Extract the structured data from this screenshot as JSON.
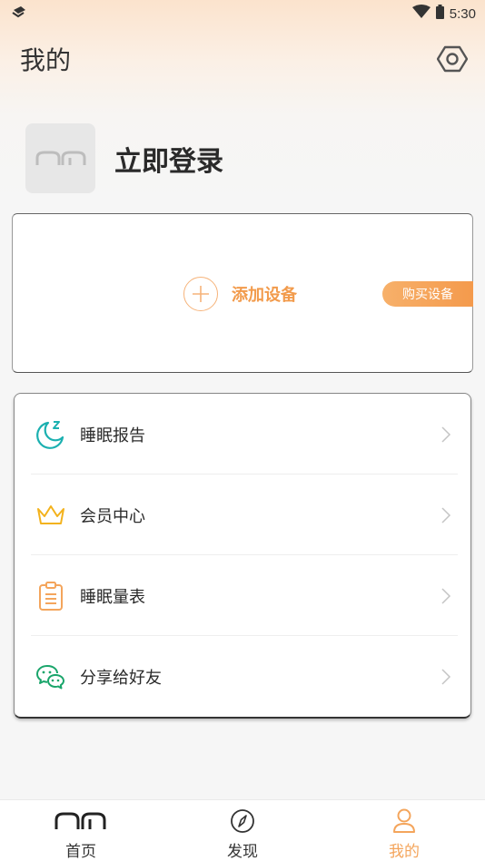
{
  "status_bar": {
    "time": "5:30"
  },
  "header": {
    "title": "我的"
  },
  "profile": {
    "login_label": "立即登录"
  },
  "device": {
    "add_label": "添加设备",
    "buy_label": "购买设备"
  },
  "menu": {
    "items": [
      {
        "label": "睡眠报告",
        "icon": "sleep-report-icon"
      },
      {
        "label": "会员中心",
        "icon": "crown-icon"
      },
      {
        "label": "睡眠量表",
        "icon": "clipboard-icon"
      },
      {
        "label": "分享给好友",
        "icon": "wechat-icon"
      }
    ]
  },
  "nav": {
    "items": [
      {
        "label": "首页",
        "icon": "home-logo-icon"
      },
      {
        "label": "发现",
        "icon": "compass-icon"
      },
      {
        "label": "我的",
        "icon": "person-icon",
        "active": true
      }
    ]
  },
  "colors": {
    "accent": "#f4a55c",
    "teal": "#1bb0b0",
    "gold": "#f3b21c",
    "green": "#1aa56b"
  }
}
